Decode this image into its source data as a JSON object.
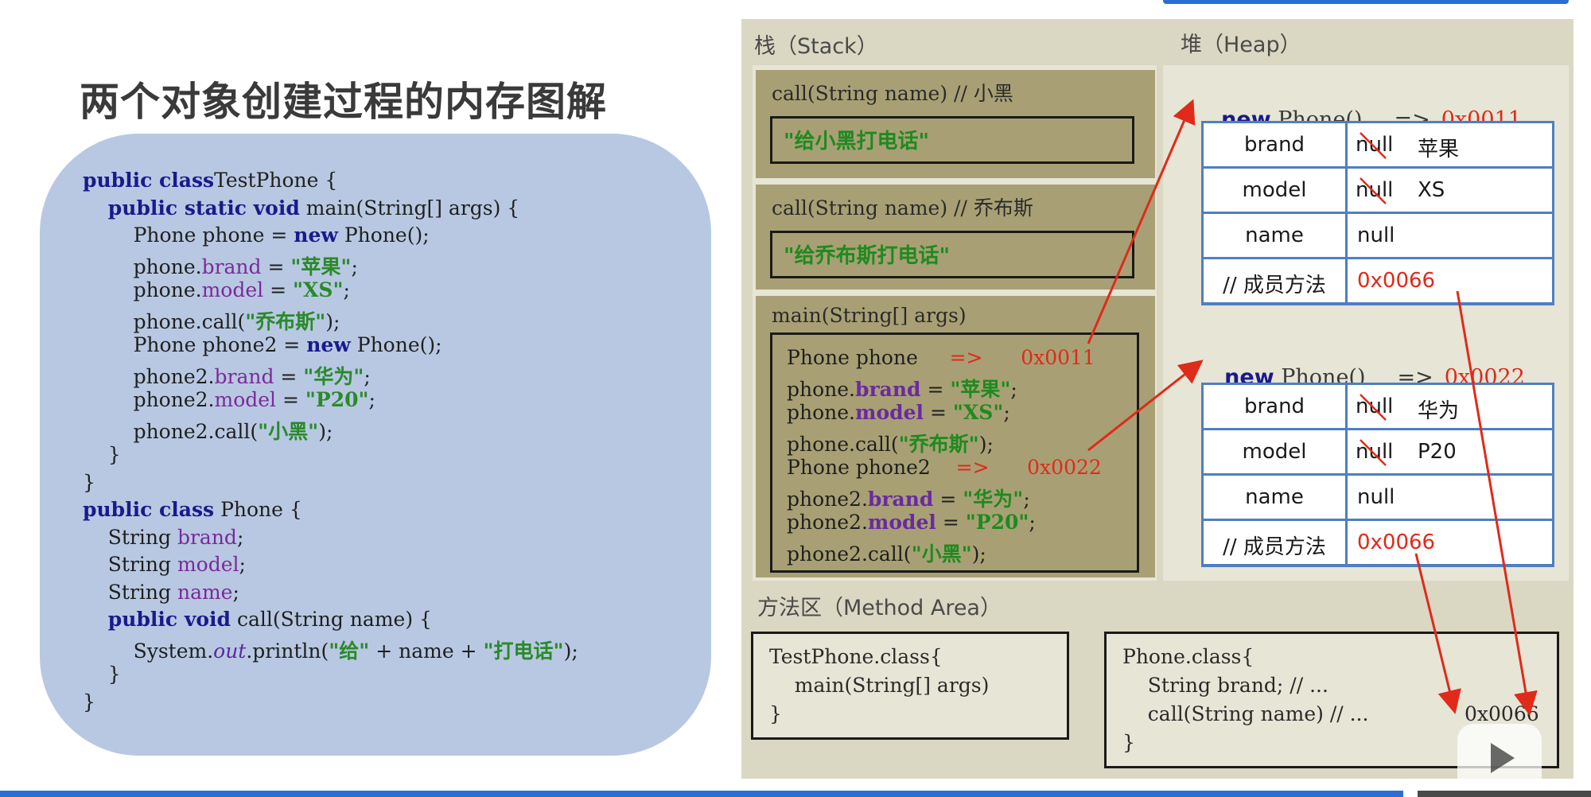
{
  "slide": {
    "title": "两个对象创建过程的内存图解"
  },
  "code": [
    [
      [
        "kw",
        "public class"
      ],
      [
        "",
        "TestPhone {"
      ]
    ],
    [
      [
        "",
        "    "
      ],
      [
        "kw",
        "public static void"
      ],
      [
        "",
        " main(String[] args) {"
      ]
    ],
    [
      [
        "",
        "        Phone phone = "
      ],
      [
        "kw",
        "new"
      ],
      [
        "",
        " Phone();"
      ]
    ],
    [
      [
        "",
        "        phone."
      ],
      [
        "fld",
        "brand"
      ],
      [
        "",
        " = "
      ],
      [
        "str",
        "\"苹果\""
      ],
      [
        "",
        ";"
      ]
    ],
    [
      [
        "",
        "        phone."
      ],
      [
        "fld",
        "model"
      ],
      [
        "",
        " = "
      ],
      [
        "str",
        "\"XS\""
      ],
      [
        "",
        ";"
      ]
    ],
    [
      [
        "",
        "        phone.call("
      ],
      [
        "str",
        "\"乔布斯\""
      ],
      [
        "",
        ");"
      ]
    ],
    [
      [
        "",
        "        Phone phone2 = "
      ],
      [
        "kw",
        "new"
      ],
      [
        "",
        " Phone();"
      ]
    ],
    [
      [
        "",
        "        phone2."
      ],
      [
        "fld",
        "brand"
      ],
      [
        "",
        " = "
      ],
      [
        "str",
        "\"华为\""
      ],
      [
        "",
        ";"
      ]
    ],
    [
      [
        "",
        "        phone2."
      ],
      [
        "fld",
        "model"
      ],
      [
        "",
        " = "
      ],
      [
        "str",
        "\"P20\""
      ],
      [
        "",
        ";"
      ]
    ],
    [
      [
        "",
        "        phone2.call("
      ],
      [
        "str",
        "\"小黑\""
      ],
      [
        "",
        ");"
      ]
    ],
    [
      [
        "",
        "    }"
      ]
    ],
    [
      [
        "",
        "}"
      ]
    ],
    [
      [
        "kw",
        "public class"
      ],
      [
        "",
        " Phone {"
      ]
    ],
    [
      [
        "",
        "    String "
      ],
      [
        "fld",
        "brand"
      ],
      [
        "",
        ";"
      ]
    ],
    [
      [
        "",
        "    String "
      ],
      [
        "fld",
        "model"
      ],
      [
        "",
        ";"
      ]
    ],
    [
      [
        "",
        "    String "
      ],
      [
        "fld",
        "name"
      ],
      [
        "",
        ";"
      ]
    ],
    [
      [
        "",
        "    "
      ],
      [
        "kw",
        "public void"
      ],
      [
        "",
        " call(String name) {"
      ]
    ],
    [
      [
        "",
        "        System."
      ],
      [
        "it",
        "out"
      ],
      [
        "",
        ".println("
      ],
      [
        "str",
        "\"给\""
      ],
      [
        "",
        " + name + "
      ],
      [
        "str",
        "\"打电话\""
      ],
      [
        "",
        ");"
      ]
    ],
    [
      [
        "",
        "    }"
      ]
    ],
    [
      [
        "",
        "}"
      ]
    ]
  ],
  "stack": {
    "label": "栈（Stack）",
    "frames": [
      {
        "title": "call(String name) // 小黑",
        "string": "\"给小黑打电话\""
      },
      {
        "title": "call(String name) // 乔布斯",
        "string": "\"给乔布斯打电话\""
      },
      {
        "title": "main(String[] args)"
      }
    ],
    "main_lines": [
      [
        [
          "",
          "Phone phone     "
        ],
        [
          "red",
          "=>"
        ],
        [
          "",
          "      "
        ],
        [
          "red",
          "0x0011"
        ]
      ],
      [
        [
          "",
          "phone."
        ],
        [
          "purple",
          "brand"
        ],
        [
          "",
          " = "
        ],
        [
          "green",
          "\"苹果\""
        ],
        [
          "",
          ";"
        ]
      ],
      [
        [
          "",
          "phone."
        ],
        [
          "purple",
          "model"
        ],
        [
          "",
          " = "
        ],
        [
          "green",
          "\"XS\""
        ],
        [
          "",
          ";"
        ]
      ],
      [
        [
          "",
          "phone.call("
        ],
        [
          "green",
          "\"乔布斯\""
        ],
        [
          "",
          ");"
        ]
      ],
      [
        [
          "",
          "Phone phone2    "
        ],
        [
          "red",
          "=>"
        ],
        [
          "",
          "      "
        ],
        [
          "red",
          "0x0022"
        ]
      ],
      [
        [
          "",
          "phone2."
        ],
        [
          "purple",
          "brand"
        ],
        [
          "",
          " = "
        ],
        [
          "green",
          "\"华为\""
        ],
        [
          "",
          ";"
        ]
      ],
      [
        [
          "",
          "phone2."
        ],
        [
          "purple",
          "model"
        ],
        [
          "",
          " = "
        ],
        [
          "green",
          "\"P20\""
        ],
        [
          "",
          ";"
        ]
      ],
      [
        [
          "",
          "phone2.call("
        ],
        [
          "green",
          "\"小黑\""
        ],
        [
          "",
          ");"
        ]
      ]
    ]
  },
  "heap": {
    "label": "堆（Heap）",
    "objects": [
      {
        "new": "new",
        "ctor": " Phone()",
        "arrow": "=>",
        "addr": "0x0011",
        "rows": [
          {
            "field": "brand",
            "old": "null",
            "value": "苹果"
          },
          {
            "field": "model",
            "old": "null",
            "value": "XS"
          },
          {
            "field": "name",
            "old": "",
            "value": "null"
          },
          {
            "field": "// 成员方法",
            "old": "",
            "value": "0x0066"
          }
        ]
      },
      {
        "new": "new",
        "ctor": " Phone()",
        "arrow": "=>",
        "addr": "0x0022",
        "rows": [
          {
            "field": "brand",
            "old": "null",
            "value": "华为"
          },
          {
            "field": "model",
            "old": "null",
            "value": "P20"
          },
          {
            "field": "name",
            "old": "",
            "value": "null"
          },
          {
            "field": "// 成员方法",
            "old": "",
            "value": "0x0066"
          }
        ]
      }
    ]
  },
  "method_area": {
    "label": "方法区（Method Area）",
    "testphone_class": [
      "TestPhone.class{",
      "    main(String[] args)",
      "}"
    ],
    "phone_class": [
      "Phone.class{",
      "    String brand; // ...",
      "    call(String name) // ...",
      "}"
    ],
    "method_addr": "0x0066"
  },
  "colors": {
    "arrow": "#e02a1a",
    "table_border": "#4f7fc0",
    "frame": "#a8a074",
    "panel": "#b8c8e2"
  },
  "icons": [
    "play-icon"
  ],
  "video_progress": 0.88
}
